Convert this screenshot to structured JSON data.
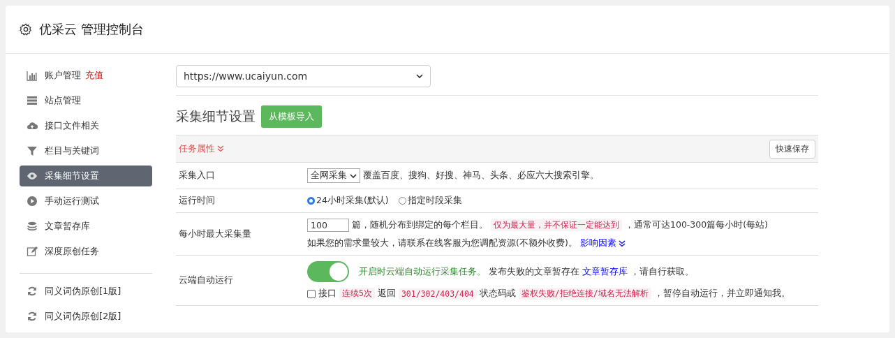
{
  "header": {
    "title": "优采云 管理控制台"
  },
  "sidebar": {
    "groups": [
      {
        "items": [
          {
            "label": "账户管理",
            "badge": "充值",
            "selected": false
          },
          {
            "label": "站点管理",
            "selected": false
          },
          {
            "label": "接口文件相关",
            "selected": false
          },
          {
            "label": "栏目与关键词",
            "selected": false
          },
          {
            "label": "采集细节设置",
            "selected": true
          },
          {
            "label": "手动运行测试",
            "selected": false
          },
          {
            "label": "文章暂存库",
            "selected": false
          },
          {
            "label": "深度原创任务",
            "selected": false
          }
        ]
      },
      {
        "items": [
          {
            "label": "同义词伪原创[1版]",
            "selected": false
          },
          {
            "label": "同义词伪原创[2版]",
            "selected": false
          }
        ]
      }
    ]
  },
  "site_select": {
    "value": "https://www.ucaiyun.com"
  },
  "section": {
    "title": "采集细节设置",
    "import_button": "从模板导入"
  },
  "panel": {
    "heading": "任务属性",
    "save_button": "快速保存",
    "rows": [
      {
        "kind": "select",
        "label": "采集入口",
        "value": "全网采集",
        "parts": [
          {
            "kind": "text",
            "text": "覆盖百度、搜狗、好搜、神马、头条、必应六大搜索引擎。"
          }
        ]
      },
      {
        "kind": "radio",
        "label": "运行时间",
        "options": [
          {
            "label": "24小时采集(默认)",
            "selected": true
          },
          {
            "label": "指定时段采集",
            "selected": false
          }
        ]
      },
      {
        "kind": "number",
        "label": "每小时最大采集量",
        "value": "100",
        "parts": [
          {
            "kind": "text",
            "text": "篇，随机分布到绑定的每个栏目。"
          },
          {
            "kind": "code",
            "text": "仅为最大量，并不保证一定能达到"
          },
          {
            "kind": "text",
            "text": "，通常可达100-300篇每小时(每站)"
          }
        ],
        "note": [
          {
            "kind": "text",
            "text": "如果您的需求量较大，请联系在线客服为您调配资源(不额外收费)。"
          },
          {
            "kind": "link",
            "text": "影响因素"
          }
        ]
      },
      {
        "kind": "toggle",
        "label": "云端自动运行",
        "on": true,
        "parts": [
          {
            "kind": "accent",
            "text": "开启时云端自动运行采集任务。"
          },
          {
            "kind": "text",
            "text": "发布失败的文章暂存在"
          },
          {
            "kind": "link",
            "text": "文章暂存库"
          },
          {
            "kind": "text",
            "text": "，请自行获取。"
          }
        ],
        "check": {
          "checked": false,
          "parts": [
            {
              "kind": "text",
              "text": "接口"
            },
            {
              "kind": "code",
              "text": "连续5次"
            },
            {
              "kind": "text",
              "text": "返回"
            },
            {
              "kind": "code",
              "text": "301/302/403/404"
            },
            {
              "kind": "text",
              "text": "状态码或"
            },
            {
              "kind": "code",
              "text": "鉴权失败/拒绝连接/域名无法解析"
            },
            {
              "kind": "text",
              "text": "，暂停自动运行，并立即通知我。"
            }
          ]
        }
      }
    ]
  }
}
